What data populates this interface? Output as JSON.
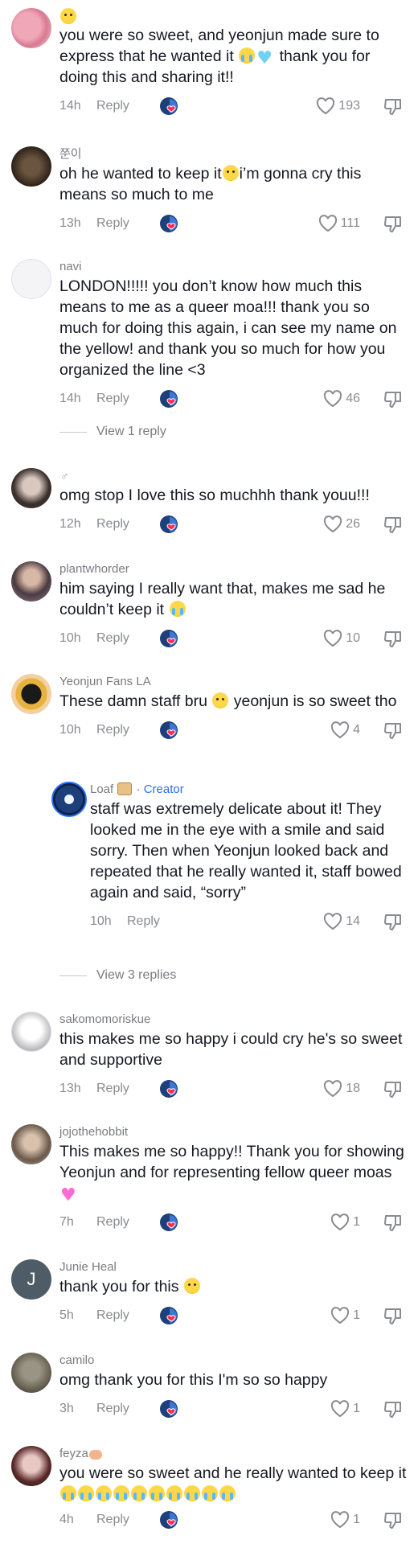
{
  "comments": [
    {
      "username": "",
      "text_before": "you were so sweet, and yeonjun made sure to express that he wanted it ",
      "text_after": " thank you for doing this and sharing it!!",
      "time": "14h",
      "reply_label": "Reply",
      "likes": "193"
    },
    {
      "username": "쭌이",
      "text_before": "oh he wanted to keep it",
      "text_after": "i’m gonna cry this means so much to me",
      "time": "13h",
      "reply_label": "Reply",
      "likes": "111"
    },
    {
      "username": "navi",
      "text_before": "LONDON!!!!! you don’t know how much this means to me as a queer moa!!! thank you so much for doing this again, i can see my name on the yellow! and thank you so much for how you organized the line <3",
      "text_after": "",
      "time": "14h",
      "reply_label": "Reply",
      "likes": "46",
      "view_replies": "View 1 reply"
    },
    {
      "username": "",
      "text_before": "omg stop I love this so muchhh thank youu!!!",
      "text_after": "",
      "time": "12h",
      "reply_label": "Reply",
      "likes": "26"
    },
    {
      "username": "plantwhorder",
      "text_before": "him saying I really want that, makes me sad he couldn’t keep it ",
      "text_after": "",
      "time": "10h",
      "reply_label": "Reply",
      "likes": "10"
    },
    {
      "username": "Yeonjun Fans LA",
      "text_before": "These damn staff bru ",
      "text_after": " yeonjun is so sweet tho",
      "time": "10h",
      "reply_label": "Reply",
      "likes": "4"
    },
    {
      "username": "Loaf",
      "creator": "· Creator",
      "text_before": "staff was extremely delicate about it! They looked me in the eye with a smile and said sorry. Then when Yeonjun looked back and repeated that he really wanted it, staff bowed again and said, “sorry”",
      "text_after": "",
      "time": "10h",
      "reply_label": "Reply",
      "likes": "14",
      "view_replies": "View 3 replies"
    },
    {
      "username": "sakomomoriskue",
      "text_before": "this makes me so happy i could cry he's so sweet and supportive",
      "text_after": "",
      "time": "13h",
      "reply_label": "Reply",
      "likes": "18"
    },
    {
      "username": "jojothehobbit",
      "text_before": "This makes me so happy!! Thank you for showing Yeonjun and for representing fellow queer moas ",
      "text_after": "",
      "time": "7h",
      "reply_label": "Reply",
      "likes": "1"
    },
    {
      "username": "Junie Heal",
      "avatar_letter": "J",
      "text_before": "thank you for this ",
      "text_after": "",
      "time": "5h",
      "reply_label": "Reply",
      "likes": "1"
    },
    {
      "username": "camilo",
      "text_before": "omg thank you for this I'm so so happy",
      "text_after": "",
      "time": "3h",
      "reply_label": "Reply",
      "likes": "1"
    },
    {
      "username": "feyza",
      "text_before": "you were so sweet and he really wanted to keep it",
      "text_after": "",
      "time": "4h",
      "reply_label": "Reply",
      "likes": "1"
    }
  ],
  "colors": {
    "accent": "#2a6df4",
    "meta": "#8a8b91",
    "text": "#161823"
  }
}
